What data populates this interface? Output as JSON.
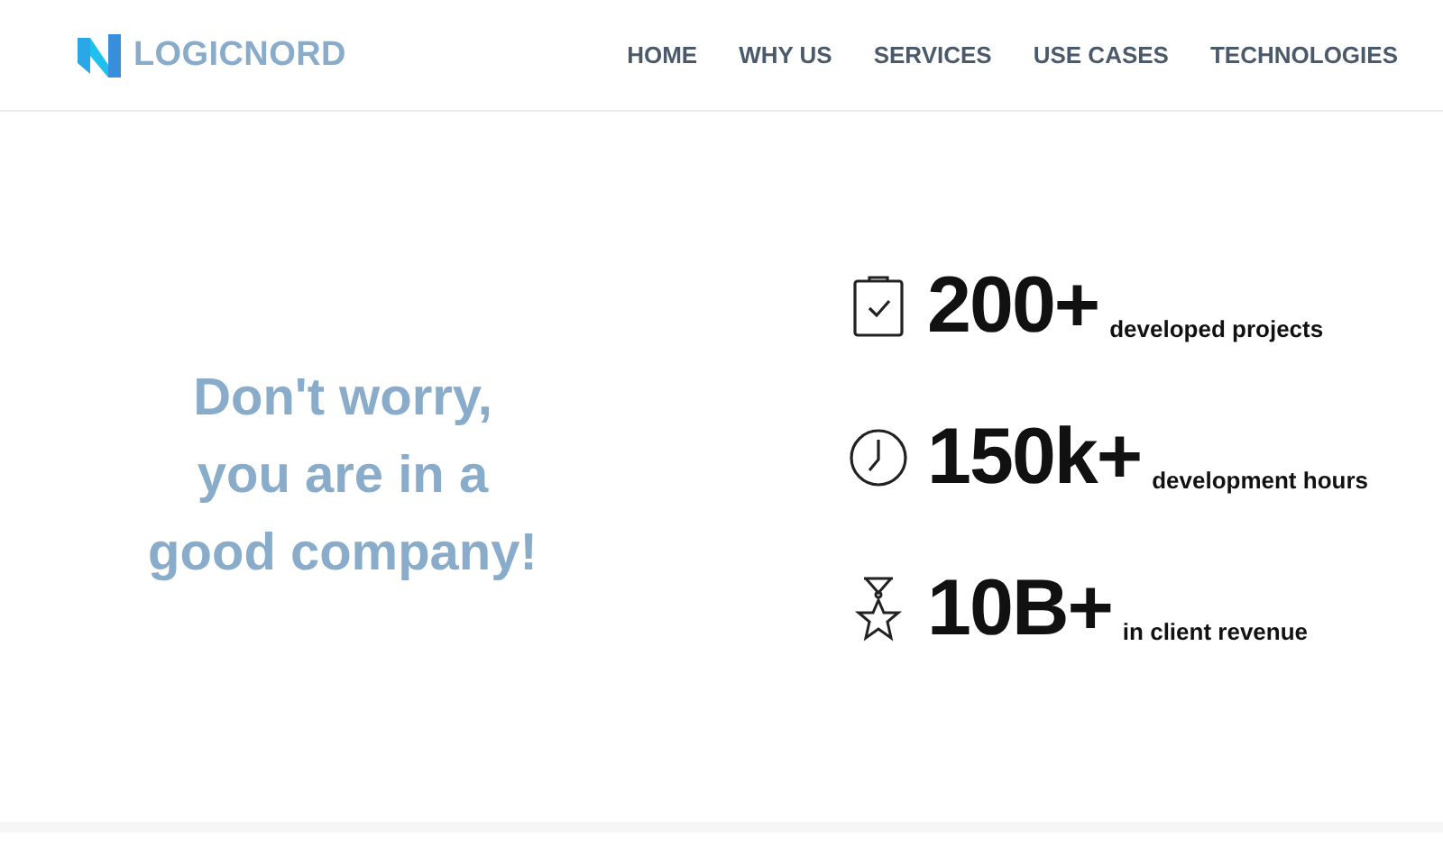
{
  "header": {
    "logo": "LOGICNORD",
    "nav": [
      {
        "label": "HOME"
      },
      {
        "label": "WHY US"
      },
      {
        "label": "SERVICES"
      },
      {
        "label": "USE CASES"
      },
      {
        "label": "TECHNOLOGIES"
      }
    ]
  },
  "hero": {
    "headline_lines": [
      "Don't worry,",
      "you are in a",
      "good company!"
    ]
  },
  "stats": [
    {
      "kind": "clipboard",
      "value": "200+",
      "label": "developed projects"
    },
    {
      "kind": "clock",
      "value": "150k+",
      "label": "development hours"
    },
    {
      "kind": "medal",
      "value": "10B+",
      "label": "in client revenue"
    }
  ]
}
